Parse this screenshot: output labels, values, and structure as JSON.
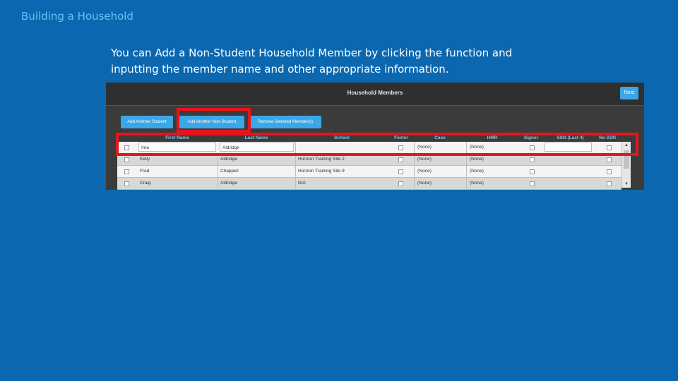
{
  "slide": {
    "title": "Building a Household",
    "body": "You can Add a Non-Student Household Member by clicking the function and inputting the member name and other appropriate information."
  },
  "screenshot": {
    "header_title": "Household Members",
    "next_label": "Next",
    "toolbar": {
      "add_student": "Add Another Student",
      "add_non_student": "Add Another Non-Student",
      "remove_selected": "Remove Selected Member(s)"
    },
    "columns": [
      "First Name",
      "Last Name",
      "School",
      "Foster",
      "Case",
      "HMR",
      "Signer",
      "SSN (Last 4)",
      "No SSN"
    ],
    "rows": [
      {
        "first": "Ima",
        "last": "Aldridge",
        "school": "",
        "case": "(None)",
        "hmr": "(None)"
      },
      {
        "first": "Kelly",
        "last": "Aldridge",
        "school": "Horizon Training Site 2",
        "case": "(None)",
        "hmr": "(None)"
      },
      {
        "first": "Fred",
        "last": "Chappell",
        "school": "Horizon Training Site 9",
        "case": "(None)",
        "hmr": "(None)"
      },
      {
        "first": "Craig",
        "last": "Aldridge",
        "school": "N/A",
        "case": "(None)",
        "hmr": "(None)"
      }
    ]
  },
  "colors": {
    "background": "#0b68b0",
    "title": "#5cc8f5",
    "button": "#3aa7e8",
    "highlight": "#e8141b"
  }
}
